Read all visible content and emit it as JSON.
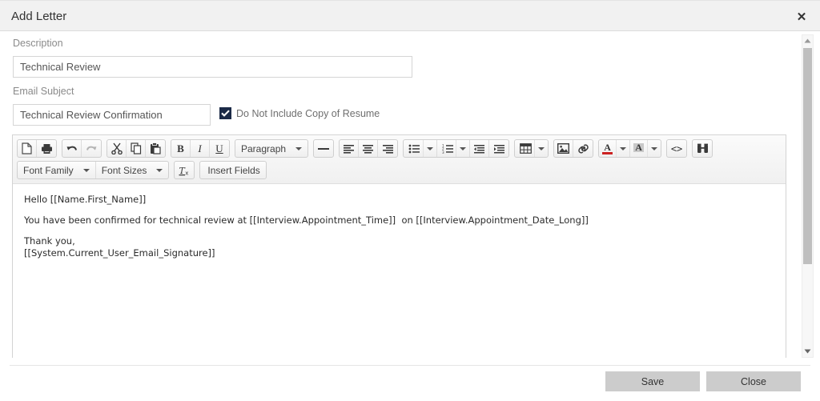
{
  "dialog": {
    "title": "Add Letter",
    "close_icon": "close-icon"
  },
  "form": {
    "description_label": "Description",
    "description_value": "Technical Review",
    "subject_label": "Email Subject",
    "subject_value": "Technical Review Confirmation",
    "checkbox_label": "Do Not Include Copy of Resume",
    "checkbox_checked": true,
    "checkbox_color": "#1b2a47"
  },
  "toolbar": {
    "row1": [
      {
        "name": "new-document-icon",
        "title": "New document"
      },
      {
        "name": "print-icon",
        "title": "Print"
      },
      {
        "name": "undo-icon",
        "title": "Undo"
      },
      {
        "name": "redo-icon",
        "title": "Redo"
      },
      {
        "name": "cut-icon",
        "title": "Cut"
      },
      {
        "name": "copy-icon",
        "title": "Copy"
      },
      {
        "name": "paste-icon",
        "title": "Paste"
      },
      {
        "name": "bold-icon",
        "label": "B"
      },
      {
        "name": "italic-icon",
        "label": "I"
      },
      {
        "name": "underline-icon",
        "label": "U"
      },
      {
        "name": "paragraph-format-dropdown",
        "label": "Paragraph"
      },
      {
        "name": "horizontal-rule-icon"
      },
      {
        "name": "align-left-icon"
      },
      {
        "name": "align-center-icon"
      },
      {
        "name": "align-right-icon"
      },
      {
        "name": "bullet-list-icon"
      },
      {
        "name": "numbered-list-icon"
      },
      {
        "name": "outdent-icon"
      },
      {
        "name": "indent-icon"
      },
      {
        "name": "table-icon"
      },
      {
        "name": "image-icon"
      },
      {
        "name": "link-icon"
      },
      {
        "name": "text-color-icon"
      },
      {
        "name": "background-color-icon"
      },
      {
        "name": "source-code-icon",
        "label": "<>"
      },
      {
        "name": "find-replace-icon"
      }
    ],
    "paragraph_label": "Paragraph",
    "font_family_label": "Font Family",
    "font_sizes_label": "Font Sizes",
    "clear_formatting_label": "Tx",
    "insert_fields_label": "Insert Fields",
    "source_code_label": "<>",
    "text_color_accent": "#cc2222",
    "background_color_accent": "#c9c9c9"
  },
  "editor_body": {
    "line1": "Hello [[Name.First_Name]]",
    "line2": "You have been confirmed for technical review at [[Interview.Appointment_Time]]  on [[Interview.Appointment_Date_Long]]",
    "line3": "Thank you,",
    "line4": "[[System.Current_User_Email_Signature]]"
  },
  "scrollbar": {
    "up_icon": "scroll-up-arrow-icon",
    "down_icon": "scroll-down-arrow-icon"
  },
  "footer": {
    "save_label": "Save",
    "close_label": "Close",
    "button_color": "#cccccc"
  }
}
